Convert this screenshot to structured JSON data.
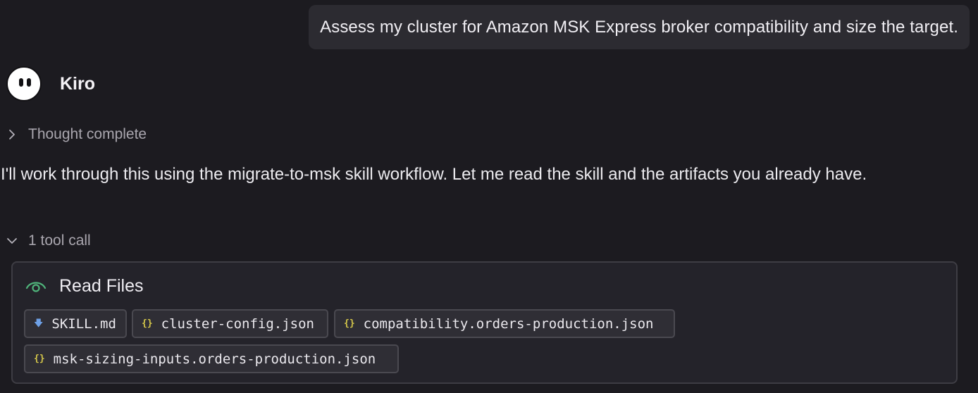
{
  "user_message": {
    "text": "Assess my cluster for Amazon MSK Express broker compatibility and size the target."
  },
  "agent": {
    "name": "Kiro",
    "avatar_icon": "ghost-face-icon"
  },
  "thought": {
    "label": "Thought complete",
    "expanded": false
  },
  "message": {
    "text": "I'll work through this using the migrate-to-msk skill workflow. Let me read the skill and the artifacts you already have."
  },
  "tool_calls": {
    "label": "1 tool call",
    "expanded": true,
    "card": {
      "title": "Read Files",
      "icon": "eye-icon",
      "files": [
        {
          "name": "SKILL.md",
          "icon": "markdown-file-icon",
          "icon_glyph": "🡇"
        },
        {
          "name": "cluster-config.json",
          "icon": "json-file-icon",
          "icon_glyph": "{}"
        },
        {
          "name": "compatibility.orders-production.json",
          "icon": "json-file-icon",
          "icon_glyph": "{}"
        },
        {
          "name": "msk-sizing-inputs.orders-production.json",
          "icon": "json-file-icon",
          "icon_glyph": "{}"
        }
      ]
    }
  },
  "colors": {
    "background": "#1c1b20",
    "bubble": "#2c2b31",
    "card": "#24232a",
    "accent_green": "#4fb37a",
    "json_icon": "#d6c84a",
    "md_icon": "#6ea0e6"
  }
}
